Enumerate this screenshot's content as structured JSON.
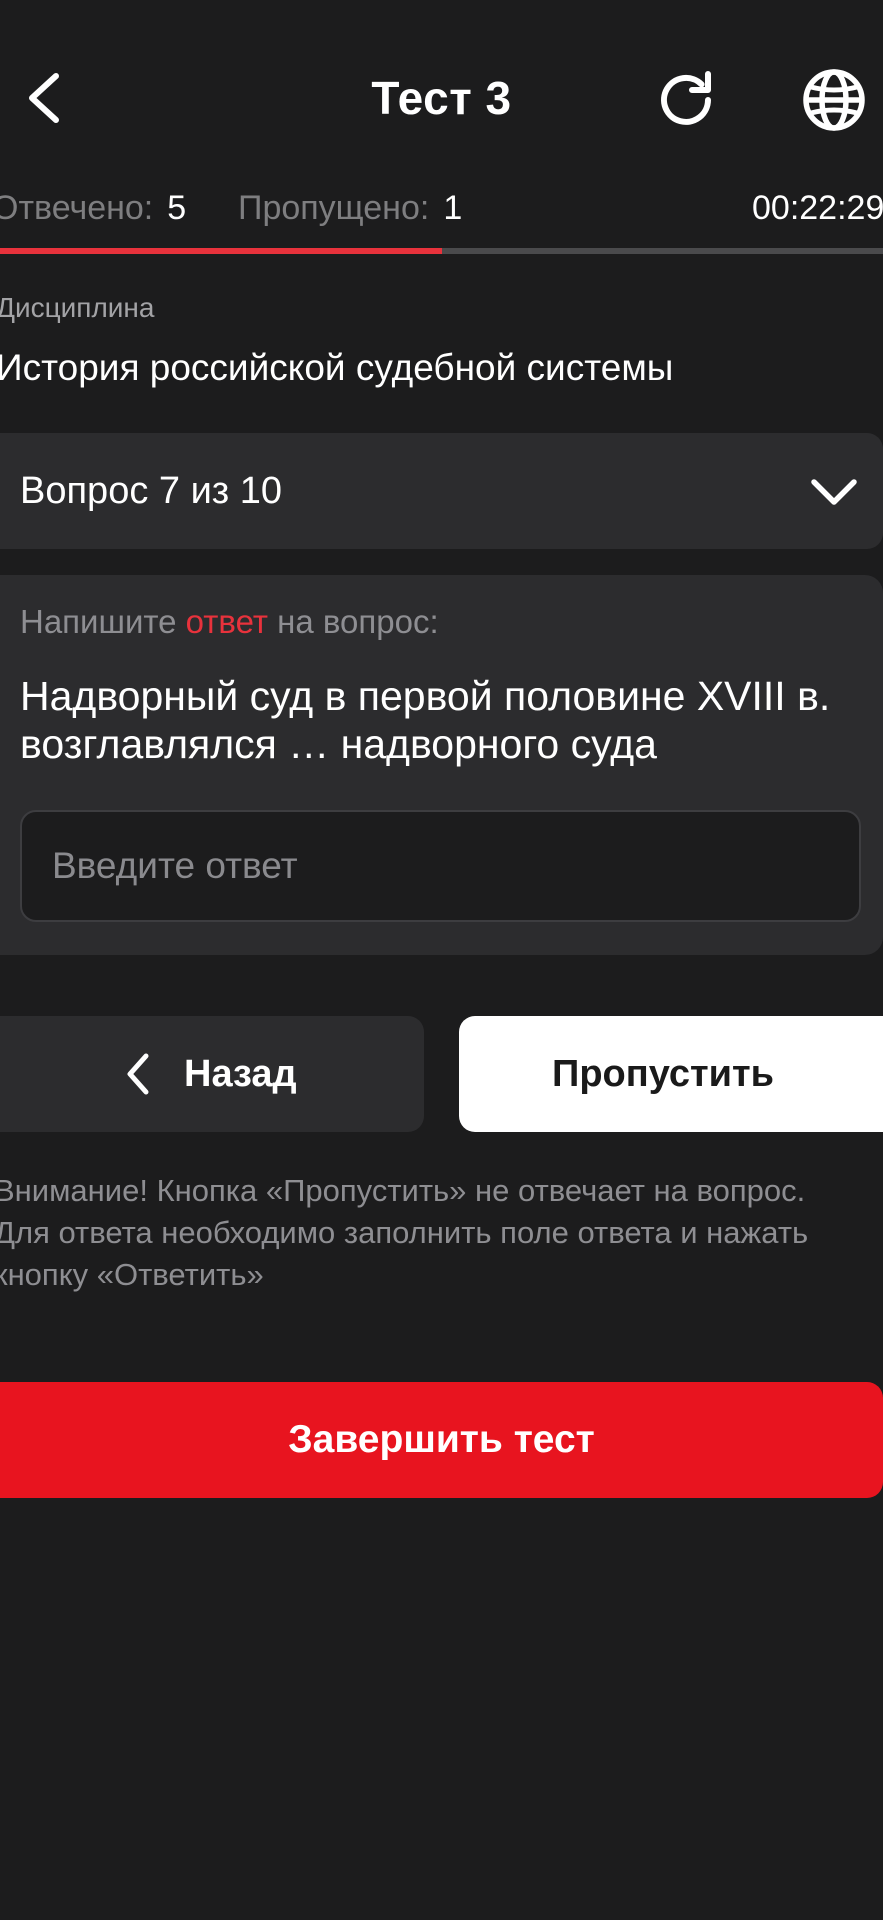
{
  "header": {
    "title": "Тест 3"
  },
  "stats": {
    "answered_label": "Отвечено:",
    "answered_value": "5",
    "skipped_label": "Пропущено:",
    "skipped_value": "1",
    "timer": "00:22:29",
    "progress_fraction": 0.5
  },
  "discipline": {
    "label": "Дисциплина",
    "name": "История российской судебной системы"
  },
  "question_selector": {
    "label": "Вопрос 7 из 10"
  },
  "question": {
    "prompt_before": "Напишите ",
    "prompt_accent": "ответ",
    "prompt_after": " на вопрос:",
    "text": "Надворный суд в первой половине XVIII в. возглавлялся … надворного суда",
    "answer_value": "",
    "answer_placeholder": "Введите ответ"
  },
  "navigation": {
    "back_label": "Назад",
    "skip_label": "Пропустить"
  },
  "warning": {
    "text": "Внимание! Кнопка «Пропустить» не отвечает на вопрос. Для ответа необходимо заполнить поле ответа и нажать кнопку «Ответить»"
  },
  "finish": {
    "label": "Завершить тест"
  },
  "colors": {
    "background": "#1c1c1d",
    "card": "#2c2c2e",
    "accent": "#e8323c",
    "finish_button": "#e8141f"
  },
  "icons": {
    "back": "chevron-left-icon",
    "refresh": "refresh-icon",
    "language": "globe-icon",
    "selector": "chevron-down-icon"
  }
}
